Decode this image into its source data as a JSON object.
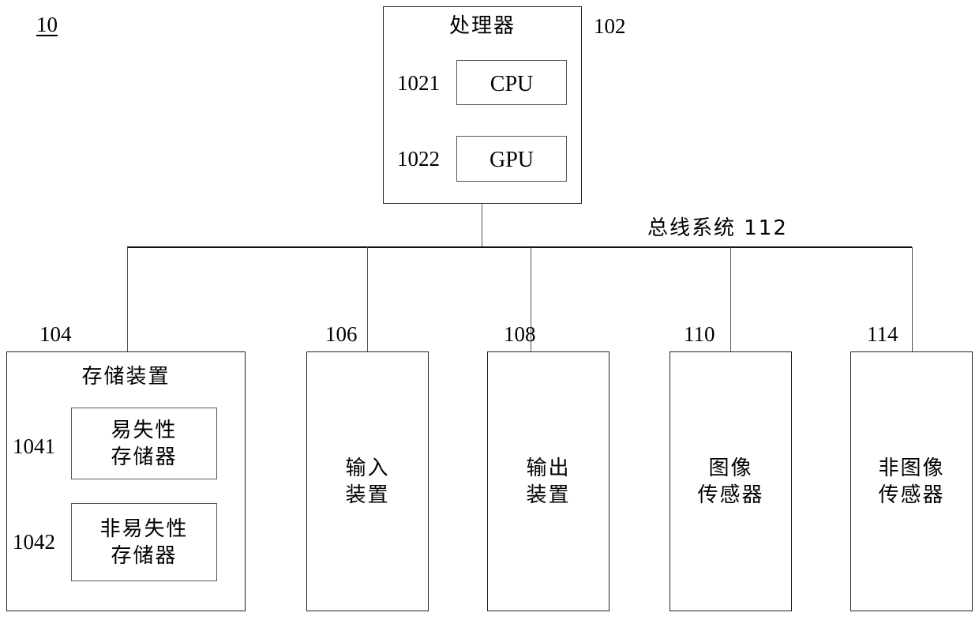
{
  "figure": {
    "figure_number": "10",
    "processor": {
      "title": "处理器",
      "ref": "102",
      "units": [
        {
          "ref": "1021",
          "label": "CPU"
        },
        {
          "ref": "1022",
          "label": "GPU"
        }
      ]
    },
    "bus": {
      "label": "总线系统 112"
    },
    "components": [
      {
        "ref": "104",
        "title": "存储装置",
        "submodules": [
          {
            "ref": "1041",
            "label": "易失性\n存储器"
          },
          {
            "ref": "1042",
            "label": "非易失性\n存储器"
          }
        ]
      },
      {
        "ref": "106",
        "title": "输入\n装置"
      },
      {
        "ref": "108",
        "title": "输出\n装置"
      },
      {
        "ref": "110",
        "title": "图像\n传感器"
      },
      {
        "ref": "114",
        "title": "非图像\n传感器"
      }
    ],
    "colors": {
      "stroke": "#555555",
      "stroke_strong": "#222222",
      "bus_line": "#111111",
      "text": "#000000",
      "background": "#ffffff"
    }
  }
}
